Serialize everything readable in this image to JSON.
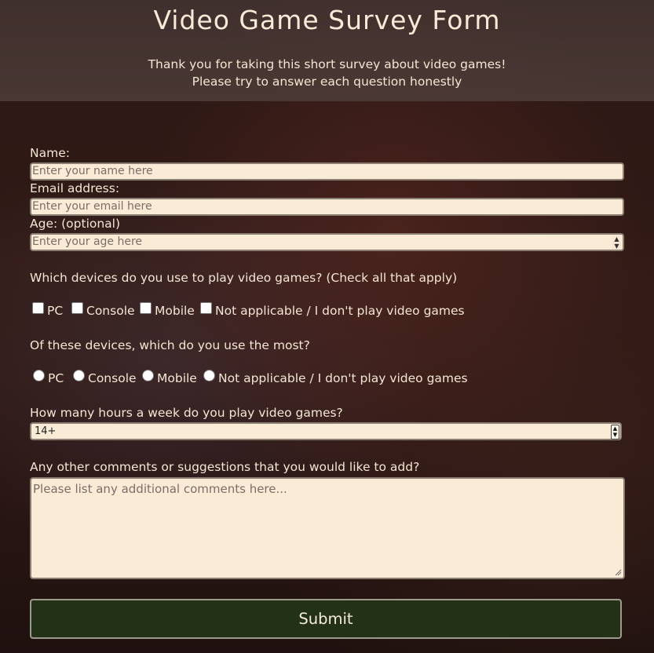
{
  "header": {
    "title": "Video Game Survey Form",
    "intro_line1": "Thank you for taking this short survey about video games!",
    "intro_line2": "Please try to answer each question honestly"
  },
  "fields": {
    "name": {
      "label": "Name:",
      "placeholder": "Enter your name here",
      "value": ""
    },
    "email": {
      "label": "Email address:",
      "placeholder": "Enter your email here",
      "value": ""
    },
    "age": {
      "label": "Age: (optional)",
      "placeholder": "Enter your age here",
      "value": ""
    }
  },
  "devices": {
    "question": "Which devices do you use to play video games? (Check all that apply)",
    "options": [
      "PC",
      "Console",
      "Mobile",
      "Not applicable / I don't play video games"
    ],
    "checked": [
      false,
      false,
      false,
      false
    ]
  },
  "most_used": {
    "question": "Of these devices, which do you use the most?",
    "options": [
      "PC",
      "Console",
      "Mobile",
      "Not applicable / I don't play video games"
    ],
    "selected": null
  },
  "hours": {
    "question": "How many hours a week do you play video games?",
    "selected": "14+"
  },
  "comments": {
    "question": "Any other comments or suggestions that you would like to add?",
    "placeholder": "Please list any additional comments here..."
  },
  "submit_label": "Submit",
  "colors": {
    "input_bg": "#faebd7",
    "submit_bg": "#233217",
    "text": "#f3e6d3"
  }
}
